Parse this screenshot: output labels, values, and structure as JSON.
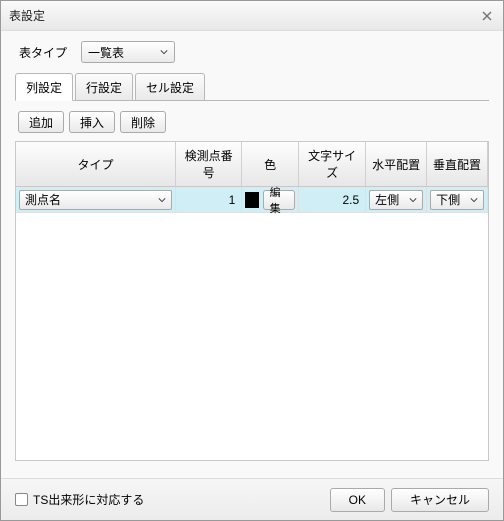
{
  "dialog": {
    "title": "表設定"
  },
  "tableType": {
    "label": "表タイプ",
    "value": "一覧表"
  },
  "tabs": [
    {
      "label": "列設定",
      "active": true
    },
    {
      "label": "行設定",
      "active": false
    },
    {
      "label": "セル設定",
      "active": false
    }
  ],
  "toolbar": {
    "add": "追加",
    "insert": "挿入",
    "delete": "削除"
  },
  "grid": {
    "headers": {
      "type": "タイプ",
      "pointNo": "検測点番号",
      "color": "色",
      "textSize": "文字サイズ",
      "hAlign": "水平配置",
      "vAlign": "垂直配置"
    },
    "rows": [
      {
        "type": "測点名",
        "pointNo": "1",
        "colorSwatch": "#000000",
        "colorEdit": "編集",
        "textSize": "2.5",
        "hAlign": "左側",
        "vAlign": "下側"
      }
    ]
  },
  "footer": {
    "tsCheckbox": "TS出来形に対応する",
    "ok": "OK",
    "cancel": "キャンセル"
  }
}
